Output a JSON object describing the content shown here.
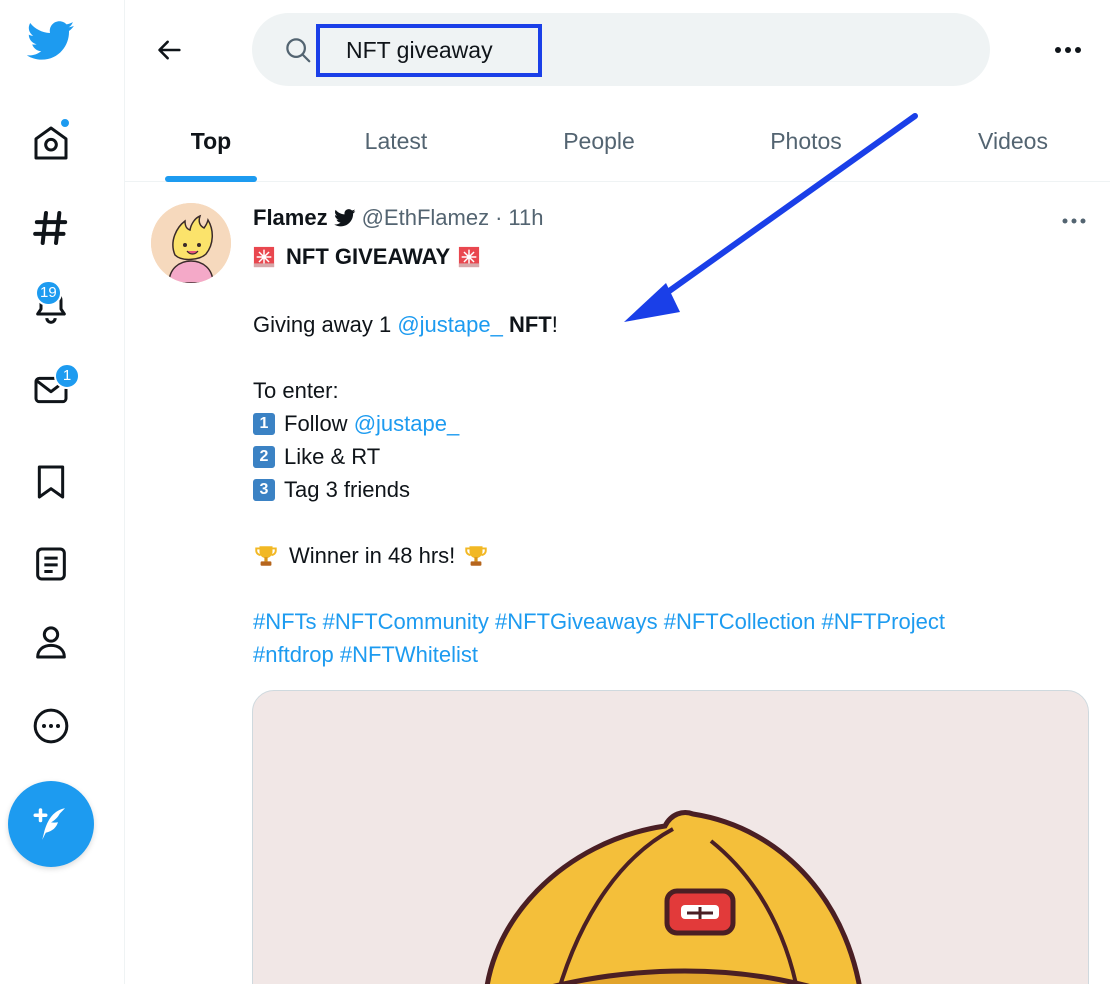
{
  "search": {
    "query": "NFT giveaway"
  },
  "badges": {
    "notifications": "19",
    "messages": "1"
  },
  "tabs": [
    {
      "label": "Top",
      "active": true
    },
    {
      "label": "Latest",
      "active": false
    },
    {
      "label": "People",
      "active": false
    },
    {
      "label": "Photos",
      "active": false
    },
    {
      "label": "Videos",
      "active": false
    }
  ],
  "tweet": {
    "author_name": "Flamez",
    "handle": "@EthFlamez",
    "separator": "·",
    "time": "11h",
    "headline": "NFT GIVEAWAY",
    "giving_prefix": "Giving away 1",
    "mention": "@justape_",
    "nft_word": "NFT",
    "exclaim": "!",
    "to_enter": "To enter:",
    "steps": [
      {
        "key": "1",
        "text": "Follow",
        "mention": "@justape_"
      },
      {
        "key": "2",
        "text": "Like & RT"
      },
      {
        "key": "3",
        "text": "Tag 3 friends"
      }
    ],
    "winner": "Winner in 48 hrs!",
    "hashtags_line1": "#NFTs #NFTCommunity #NFTGiveaways #NFTCollection #NFTProject",
    "hashtags_line2": "#nftdrop #NFTWhitelist"
  },
  "colors": {
    "accent": "#1d9bf0",
    "annotation": "#1a3fe8",
    "secondary_text": "#536471"
  },
  "icons": {
    "logo": "twitter-bird-icon",
    "home": "home-icon",
    "explore": "hashtag-icon",
    "notifications": "bell-icon",
    "messages": "envelope-icon",
    "bookmarks": "bookmark-icon",
    "lists": "list-icon",
    "profile": "person-icon",
    "more": "more-circle-icon",
    "compose": "compose-icon",
    "back": "arrow-left-icon",
    "search": "search-icon",
    "overflow": "ellipsis-icon",
    "verified": "bird-badge-icon",
    "siren": "siren-icon",
    "trophy": "trophy-icon"
  }
}
